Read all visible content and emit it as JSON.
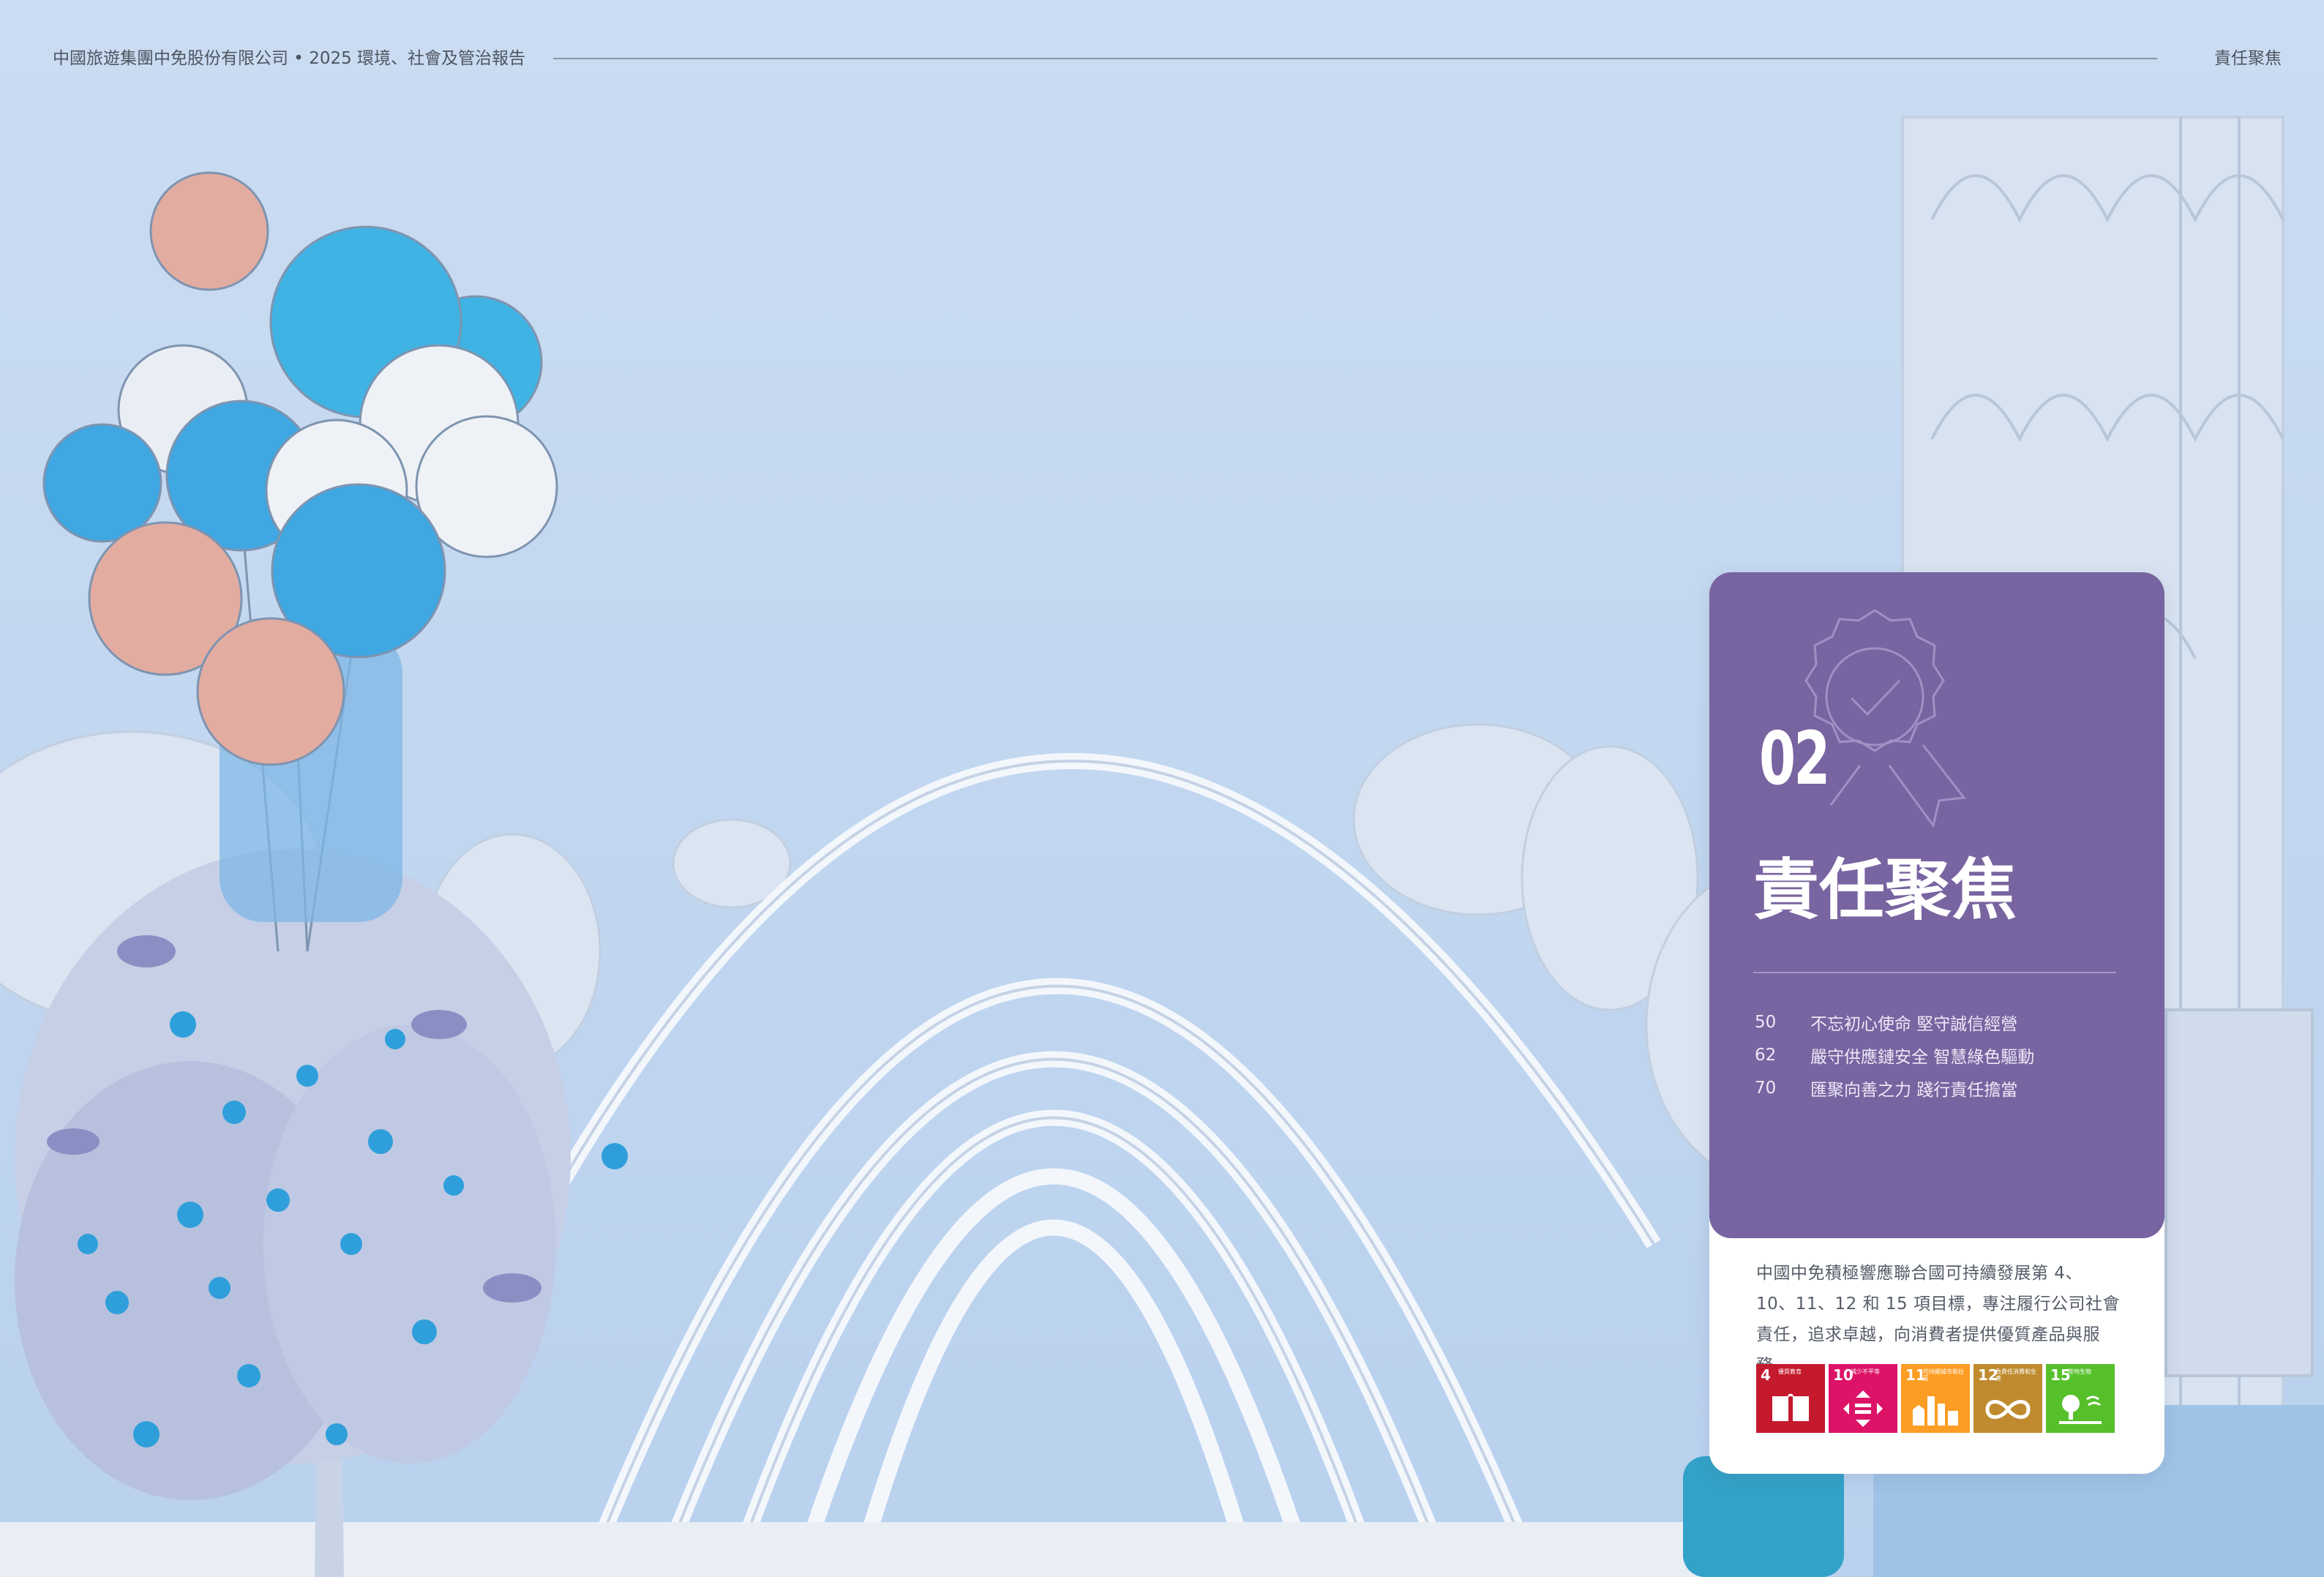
{
  "header": {
    "report_title": "中國旅遊集團中免股份有限公司 • 2025 環境、社會及管治報告",
    "section_name": "責任聚焦"
  },
  "chapter": {
    "number": "02",
    "title": "責任聚焦",
    "contents": [
      {
        "page": "50",
        "title": "不忘初心使命 堅守誠信經營"
      },
      {
        "page": "62",
        "title": "嚴守供應鏈安全 智慧綠色驅動"
      },
      {
        "page": "70",
        "title": "匯聚向善之力 踐行責任擔當"
      }
    ],
    "description_lines": [
      "中國中免積極響應聯合國可持續發展第 4、",
      "10、11、12 和 15 項目標，專注履行公司社會",
      "責任，追求卓越，向消費者提供優質產品與服務。"
    ]
  },
  "sdg_icons": [
    {
      "number": "4",
      "label": "優質教育",
      "color": "#c5192d",
      "icon": "book-icon"
    },
    {
      "number": "10",
      "label": "減少不平等",
      "color": "#dd1367",
      "icon": "equality-icon"
    },
    {
      "number": "11",
      "label": "可持續城市和社區",
      "color": "#fd9d24",
      "icon": "city-icon"
    },
    {
      "number": "12",
      "label": "負責任消費和生產",
      "color": "#bf8b2e",
      "icon": "infinity-icon"
    },
    {
      "number": "15",
      "label": "陸地生物",
      "color": "#56c02b",
      "icon": "tree-icon"
    }
  ],
  "colors": {
    "background": "#c9dbf0",
    "card_purple": "#7864a0",
    "balloon_blue": "#3fb3e3",
    "balloon_pink": "#e3aca1"
  }
}
